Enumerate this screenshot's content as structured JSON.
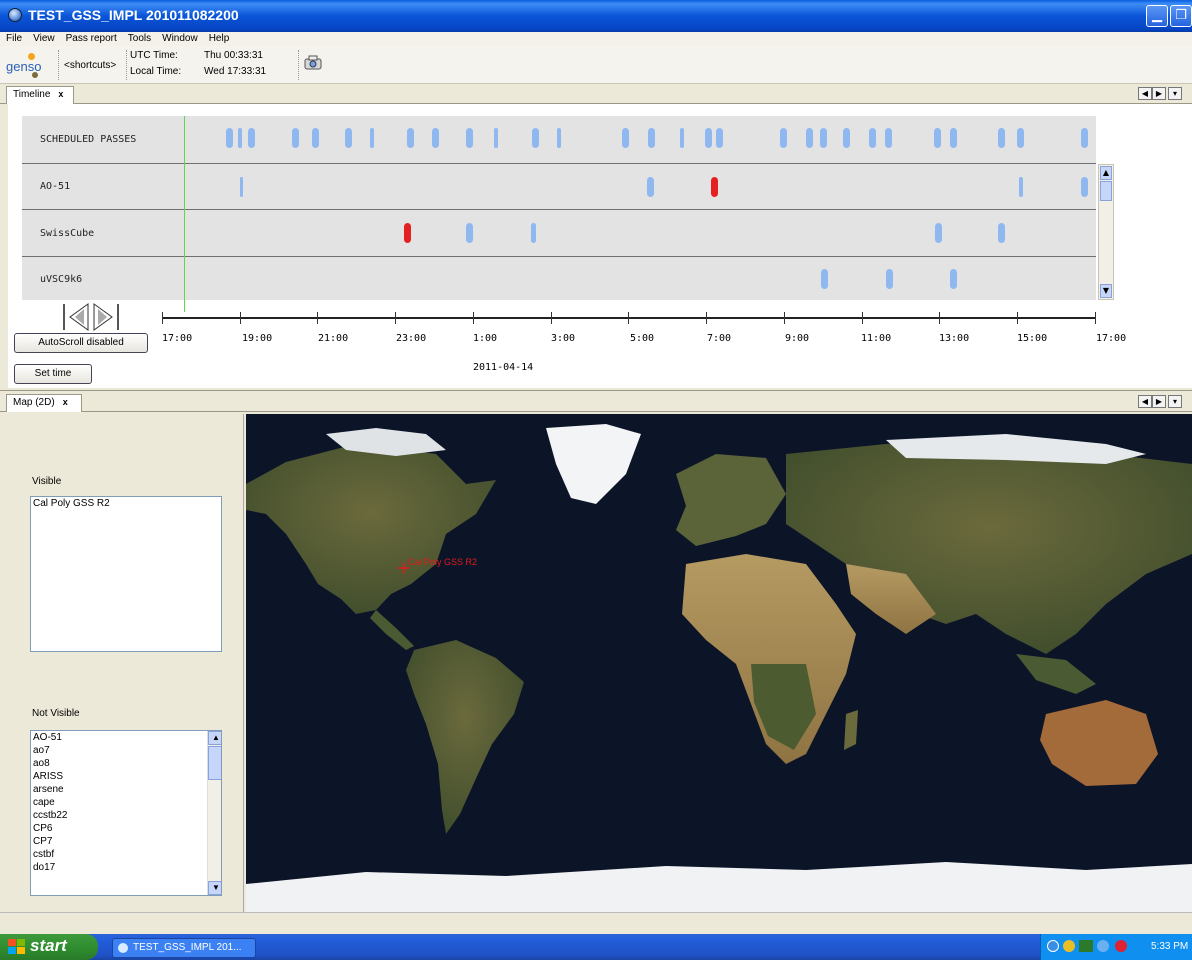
{
  "window": {
    "title": "TEST_GSS_IMPL 201011082200"
  },
  "menu": [
    "File",
    "View",
    "Pass report",
    "Tools",
    "Window",
    "Help"
  ],
  "toolbar": {
    "logo_text": "genso",
    "shortcuts": "<shortcuts>",
    "utc_label": "UTC Time:",
    "utc_value": "Thu 00:33:31",
    "local_label": "Local Time:",
    "local_value": "Wed 17:33:31"
  },
  "timeline": {
    "tab_label": "Timeline",
    "rows": [
      "SCHEDULED PASSES",
      "AO-51",
      "SwissCube",
      "uVSC9k6"
    ],
    "time_labels": [
      "17:00",
      "19:00",
      "21:00",
      "23:00",
      "1:00",
      "3:00",
      "5:00",
      "7:00",
      "9:00",
      "11:00",
      "13:00",
      "15:00",
      "17:00"
    ],
    "date": "2011-04-14",
    "autoscroll_label": "AutoScroll disabled",
    "settime_label": "Set time",
    "colors": {
      "pass": "#8fb7f0",
      "active_pass": "#e42020",
      "now_line": "#5ad65a"
    }
  },
  "map": {
    "tab_label": "Map (2D)",
    "visible_label": "Visible",
    "visible_items": [
      "Cal Poly GSS R2"
    ],
    "not_visible_label": "Not Visible",
    "not_visible_items": [
      "AO-51",
      "ao7",
      "ao8",
      "ARISS",
      "arsene",
      "cape",
      "ccstb22",
      "CP6",
      "CP7",
      "cstbf",
      "do17"
    ],
    "station_marker": "Cal Poly GSS R2"
  },
  "taskbar": {
    "start_label": "start",
    "task_label": "TEST_GSS_IMPL 201...",
    "clock": "5:33 PM"
  }
}
